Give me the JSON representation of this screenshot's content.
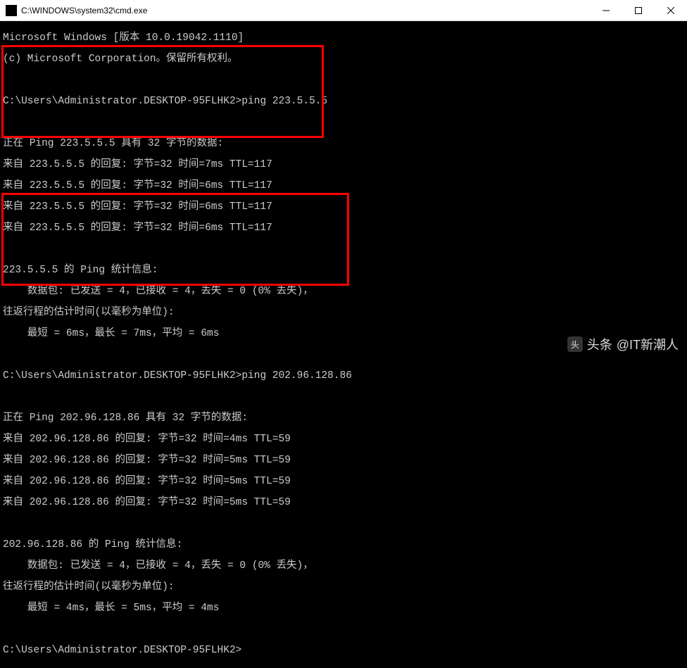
{
  "window": {
    "title": "C:\\WINDOWS\\system32\\cmd.exe",
    "icon": "cmd-icon"
  },
  "header": {
    "line1": "Microsoft Windows [版本 10.0.19042.1110]",
    "line2": "(c) Microsoft Corporation。保留所有权利。"
  },
  "ping1": {
    "prompt": "C:\\Users\\Administrator.DESKTOP-95FLHK2>",
    "command": "ping 223.5.5.5",
    "target": "223.5.5.5",
    "banner": "正在 Ping 223.5.5.5 具有 32 字节的数据:",
    "replies": [
      "来自 223.5.5.5 的回复: 字节=32 时间=7ms TTL=117",
      "来自 223.5.5.5 的回复: 字节=32 时间=6ms TTL=117",
      "来自 223.5.5.5 的回复: 字节=32 时间=6ms TTL=117",
      "来自 223.5.5.5 的回复: 字节=32 时间=6ms TTL=117"
    ],
    "stats_header": "223.5.5.5 的 Ping 统计信息:",
    "stats_packets": "    数据包: 已发送 = 4，已接收 = 4，丢失 = 0 (0% 丢失)，",
    "stats_rtt_header": "往返行程的估计时间(以毫秒为单位):",
    "stats_rtt": "    最短 = 6ms，最长 = 7ms，平均 = 6ms"
  },
  "ping2": {
    "prompt": "C:\\Users\\Administrator.DESKTOP-95FLHK2>",
    "command": "ping 202.96.128.86",
    "target": "202.96.128.86",
    "banner": "正在 Ping 202.96.128.86 具有 32 字节的数据:",
    "replies": [
      "来自 202.96.128.86 的回复: 字节=32 时间=4ms TTL=59",
      "来自 202.96.128.86 的回复: 字节=32 时间=5ms TTL=59",
      "来自 202.96.128.86 的回复: 字节=32 时间=5ms TTL=59",
      "来自 202.96.128.86 的回复: 字节=32 时间=5ms TTL=59"
    ],
    "stats_header": "202.96.128.86 的 Ping 统计信息:",
    "stats_packets": "    数据包: 已发送 = 4，已接收 = 4，丢失 = 0 (0% 丢失)，",
    "stats_rtt_header": "往返行程的估计时间(以毫秒为单位):",
    "stats_rtt": "    最短 = 4ms，最长 = 5ms，平均 = 4ms"
  },
  "final_prompt": "C:\\Users\\Administrator.DESKTOP-95FLHK2>",
  "watermark": {
    "label": "头条",
    "handle": "@IT新潮人"
  }
}
